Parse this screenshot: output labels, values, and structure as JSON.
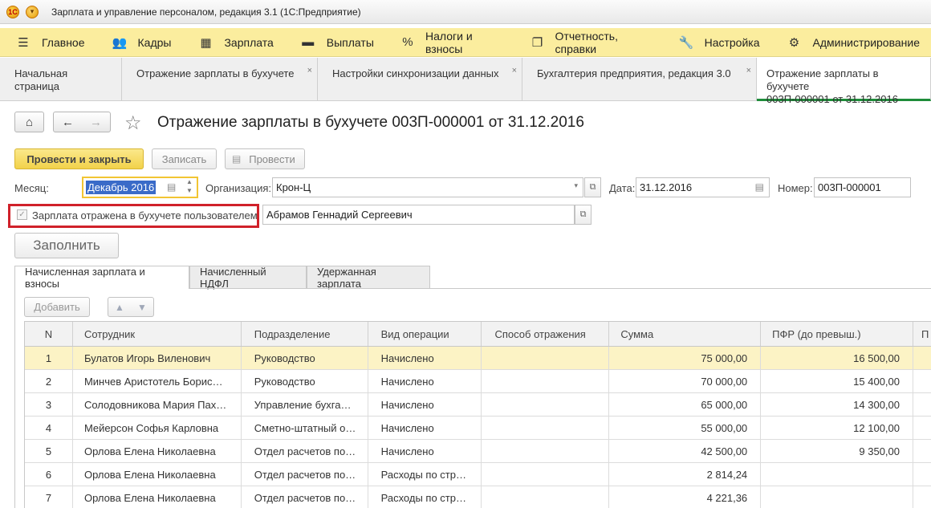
{
  "window": {
    "title": "Зарплата и управление персоналом, редакция 3.1  (1С:Предприятие)"
  },
  "main_menu": [
    {
      "icon": "hamburger-icon",
      "glyph": "☰",
      "label": "Главное"
    },
    {
      "icon": "people-icon",
      "glyph": "👥",
      "label": "Кадры"
    },
    {
      "icon": "calculator-icon",
      "glyph": "▦",
      "label": "Зарплата"
    },
    {
      "icon": "wallet-icon",
      "glyph": "▬",
      "label": "Выплаты"
    },
    {
      "icon": "percent-icon",
      "glyph": "%",
      "label": "Налоги и взносы"
    },
    {
      "icon": "reports-icon",
      "glyph": "❐",
      "label": "Отчетность, справки"
    },
    {
      "icon": "wrench-icon",
      "glyph": "🔧",
      "label": "Настройка"
    },
    {
      "icon": "gear-icon",
      "glyph": "⚙",
      "label": "Администрирование"
    }
  ],
  "open_tabs": [
    {
      "label": "Начальная страница",
      "closable": false
    },
    {
      "label": "Отражение зарплаты в бухучете",
      "closable": true
    },
    {
      "label": "Настройки синхронизации данных",
      "closable": true
    },
    {
      "label": "Бухгалтерия предприятия, редакция 3.0",
      "closable": true
    },
    {
      "label": "Отражение зарплаты в бухучете 003П-000001 от 31.12.2016",
      "line1": "Отражение зарплаты в бухучете",
      "line2": "003П-000001 от 31.12.2016",
      "closable": false,
      "active": true
    }
  ],
  "document": {
    "title": "Отражение зарплаты в бухучете 003П-000001 от 31.12.2016"
  },
  "toolbar": {
    "post_close": "Провести и закрыть",
    "save": "Записать",
    "post": "Провести"
  },
  "form": {
    "month_label": "Месяц:",
    "month_value": "Декабрь 2016",
    "org_label": "Организация:",
    "org_value": "Крон-Ц",
    "date_label": "Дата:",
    "date_value": "31.12.2016",
    "number_label": "Номер:",
    "number_value": "003П-000001",
    "checkbox_label": "Зарплата отражена в бухучете пользователем",
    "checkbox_checked": true,
    "user_value": "Абрамов Геннадий Сергеевич",
    "fill_button": "Заполнить"
  },
  "inner_tabs": [
    {
      "label": "Начисленная зарплата и взносы",
      "active": true
    },
    {
      "label": "Начисленный НДФЛ"
    },
    {
      "label": "Удержанная зарплата"
    }
  ],
  "table_toolbar": {
    "add": "Добавить"
  },
  "table": {
    "columns": [
      "N",
      "Сотрудник",
      "Подразделение",
      "Вид операции",
      "Способ отражения",
      "Сумма",
      "ПФР (до превыш.)",
      "П"
    ],
    "rows": [
      {
        "n": "1",
        "employee": "Булатов Игорь Виленович",
        "department": "Руководство",
        "operation": "Начислено",
        "method": "",
        "sum": "75 000,00",
        "pfr": "16 500,00"
      },
      {
        "n": "2",
        "employee": "Минчев Аристотель Борис…",
        "department": "Руководство",
        "operation": "Начислено",
        "method": "",
        "sum": "70 000,00",
        "pfr": "15 400,00"
      },
      {
        "n": "3",
        "employee": "Солодовникова Мария Пах…",
        "department": "Управление бухга…",
        "operation": "Начислено",
        "method": "",
        "sum": "65 000,00",
        "pfr": "14 300,00"
      },
      {
        "n": "4",
        "employee": "Мейерсон Софья Карловна",
        "department": "Сметно-штатный о…",
        "operation": "Начислено",
        "method": "",
        "sum": "55 000,00",
        "pfr": "12 100,00"
      },
      {
        "n": "5",
        "employee": "Орлова Елена Николаевна",
        "department": "Отдел расчетов по…",
        "operation": "Начислено",
        "method": "",
        "sum": "42 500,00",
        "pfr": "9 350,00"
      },
      {
        "n": "6",
        "employee": "Орлова Елена Николаевна",
        "department": "Отдел расчетов по…",
        "operation": "Расходы по стр…",
        "method": "",
        "sum": "2 814,24",
        "pfr": ""
      },
      {
        "n": "7",
        "employee": "Орлова Елена Николаевна",
        "department": "Отдел расчетов по…",
        "operation": "Расходы по стр…",
        "method": "",
        "sum": "4 221,36",
        "pfr": ""
      }
    ]
  },
  "colors": {
    "menu_bg": "#fbed9e",
    "primary_button": "#f2d24a",
    "active_tab_underline": "#1e8c3a",
    "highlight_border": "#d0212a",
    "selected_row": "#fcf3c5",
    "selected_text_bg": "#3a6bc8"
  }
}
